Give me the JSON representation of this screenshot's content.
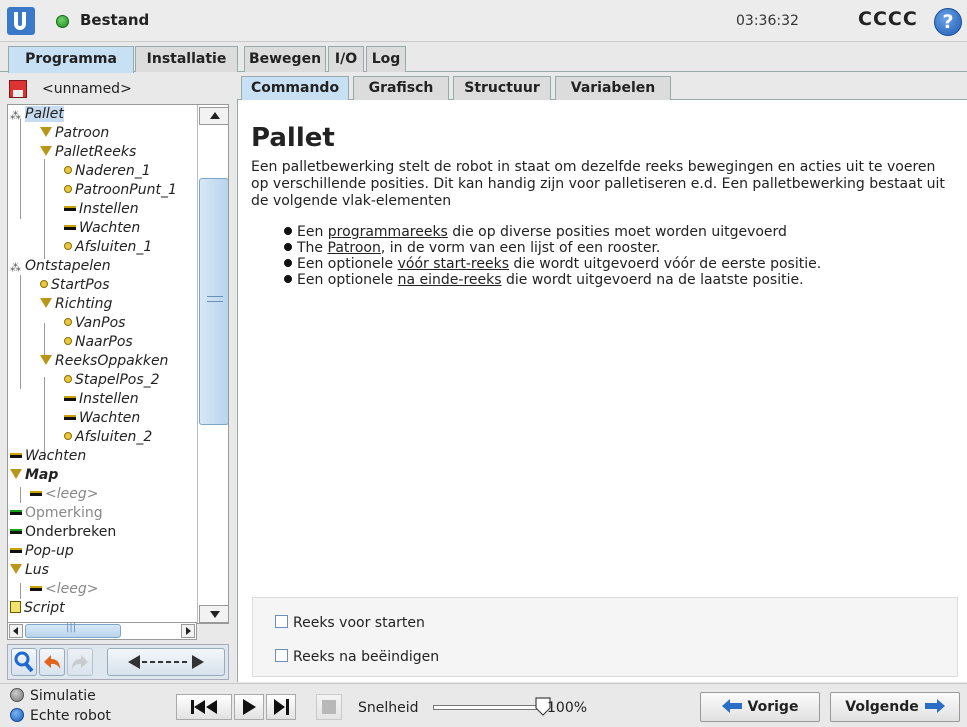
{
  "header": {
    "title": "Bestand",
    "clock": "03:36:32",
    "robot_name": "CCCC",
    "help_label": "?"
  },
  "main_tabs": [
    "Programma",
    "Installatie",
    "Bewegen",
    "I/O",
    "Log"
  ],
  "program": {
    "name": "<unnamed>"
  },
  "sub_tabs": [
    "Commando",
    "Grafisch",
    "Structuur",
    "Variabelen"
  ],
  "tree": [
    {
      "label": "Pallet",
      "icon": "pallet-icon"
    },
    {
      "label": "Patroon",
      "icon": "pattern-icon"
    },
    {
      "label": "PalletReeks",
      "icon": "sequence-icon"
    },
    {
      "label": "Naderen_1",
      "icon": "waypoint-icon"
    },
    {
      "label": "PatroonPunt_1",
      "icon": "waypoint-icon"
    },
    {
      "label": "Instellen",
      "icon": "set-icon"
    },
    {
      "label": "Wachten",
      "icon": "wait-icon"
    },
    {
      "label": "Afsluiten_1",
      "icon": "waypoint-icon"
    },
    {
      "label": "Ontstapelen",
      "icon": "destack-icon"
    },
    {
      "label": "StartPos",
      "icon": "waypoint-icon"
    },
    {
      "label": "Richting",
      "icon": "direction-icon"
    },
    {
      "label": "VanPos",
      "icon": "waypoint-icon"
    },
    {
      "label": "NaarPos",
      "icon": "waypoint-icon"
    },
    {
      "label": "ReeksOppakken",
      "icon": "sequence-icon"
    },
    {
      "label": "StapelPos_2",
      "icon": "waypoint-icon"
    },
    {
      "label": "Instellen",
      "icon": "set-icon"
    },
    {
      "label": "Wachten",
      "icon": "wait-icon"
    },
    {
      "label": "Afsluiten_2",
      "icon": "waypoint-icon"
    },
    {
      "label": "Wachten",
      "icon": "wait-icon"
    },
    {
      "label": "Map",
      "icon": "folder-icon"
    },
    {
      "label": "<leeg>",
      "icon": "empty-icon"
    },
    {
      "label": "Opmerking",
      "icon": "comment-icon"
    },
    {
      "label": "Onderbreken",
      "icon": "halt-icon"
    },
    {
      "label": "Pop-up",
      "icon": "popup-icon"
    },
    {
      "label": "Lus",
      "icon": "loop-icon"
    },
    {
      "label": "<leeg>",
      "icon": "empty-icon"
    },
    {
      "label": "Script",
      "icon": "script-icon"
    }
  ],
  "tree_toolbar": {
    "move_label": "◄----►"
  },
  "content": {
    "title": "Pallet",
    "description": "Een palletbewerking stelt de robot in staat om dezelfde reeks bewegingen en acties uit te voeren op verschillende posities. Dit kan handig zijn voor palletiseren e.d. Een palletbewerking bestaat uit de volgende vlak-elementen",
    "bullets": [
      {
        "pre": "Een ",
        "link": "programmareeks",
        "post": " die op diverse posities moet worden uitgevoerd"
      },
      {
        "pre": "The ",
        "link": "Patroon",
        "post": ", in de vorm van een lijst of een rooster."
      },
      {
        "pre": "Een optionele ",
        "link": "vóór start-reeks",
        "post": " die wordt uitgevoerd vóór de eerste positie."
      },
      {
        "pre": "Een optionele ",
        "link": "na einde-reeks",
        "post": " die wordt uitgevoerd na de laatste positie."
      }
    ],
    "options": {
      "before_start": "Reeks voor starten",
      "after_end": "Reeks na beëindigen"
    }
  },
  "bottom": {
    "simulation": "Simulatie",
    "real_robot": "Echte robot",
    "speed_label": "Snelheid",
    "speed_value": "100%",
    "speed_fraction": 1.0,
    "prev": "Vorige",
    "next": "Volgende"
  },
  "colors": {
    "active_tab": "#c7e0f4",
    "status_green": "#1c8a1c",
    "accent_blue": "#1e5bb5"
  }
}
